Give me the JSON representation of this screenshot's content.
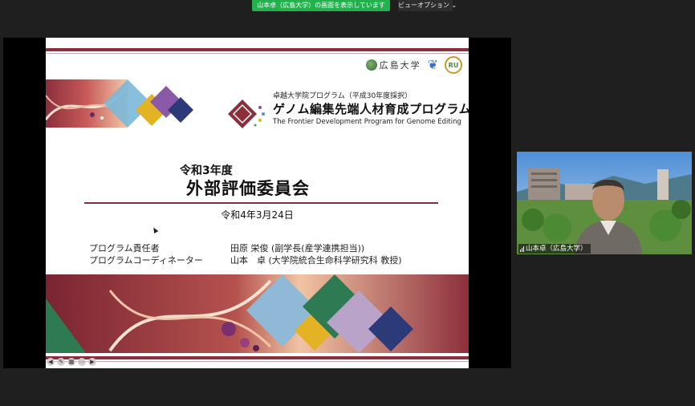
{
  "share_banner": "山本卓（広島大学）の画面を表示しています",
  "view_options": "ビューオプション",
  "logos": {
    "university": "広島大学",
    "ru": "RU"
  },
  "program": {
    "subtitle": "卓越大学院プログラム（平成30年度採択）",
    "title": "ゲノム編集先端人材育成プログラム",
    "english": "The Frontier Development Program for Genome Editing"
  },
  "meeting": {
    "year": "令和3年度",
    "name": "外部評価委員会",
    "date": "令和4年3月24日"
  },
  "roles": [
    {
      "label": "プログラム責任者",
      "name": "田原 栄俊 (副学長(産学連携担当))"
    },
    {
      "label": "プログラムコーディネーター",
      "name": "山本　卓 (大学院統合生命科学研究科 教授)"
    }
  ],
  "video": {
    "participant_name": "山本卓（広島大学）"
  },
  "colors": {
    "brand": "#8c2f3c",
    "share_banner": "#23b14d",
    "background": "#1f1f1f"
  },
  "icons": {
    "cursor": "arrow-cursor-icon",
    "signal": "signal-icon",
    "chevron": "chevron-down-icon"
  }
}
